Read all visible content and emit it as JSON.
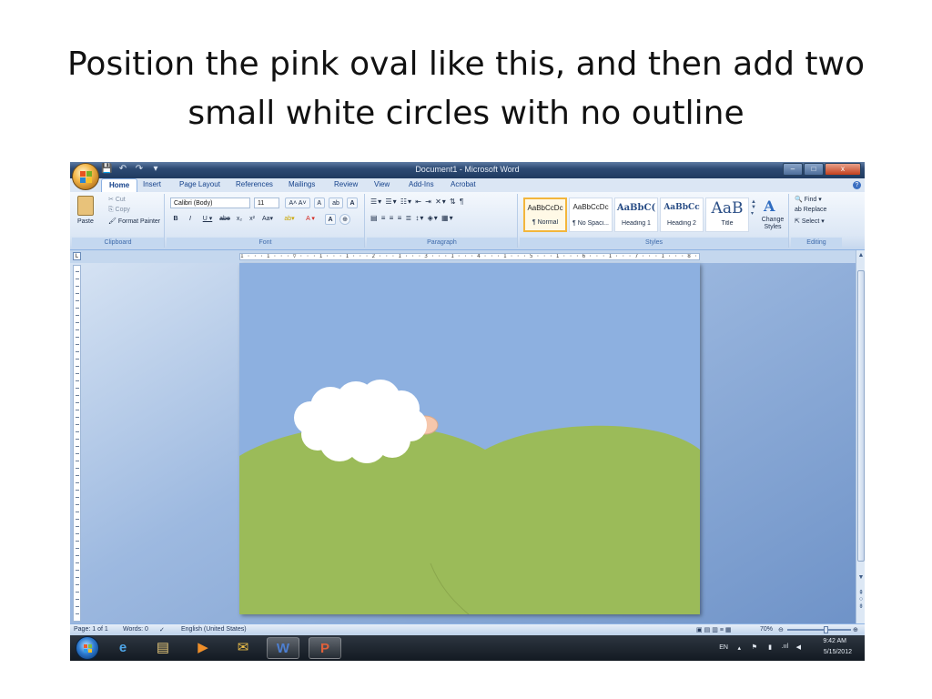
{
  "slide": {
    "title_line1": "Position the pink oval like this, and then add two",
    "title_line2": "small white circles with no outline"
  },
  "window": {
    "title": "Document1 - Microsoft Word",
    "controls": {
      "minimize": "–",
      "maximize": "□",
      "close": "x"
    }
  },
  "quick_access": {
    "save": "💾",
    "undo": "↶",
    "redo": "↷",
    "customize": "▾"
  },
  "tabs": [
    "Home",
    "Insert",
    "Page Layout",
    "References",
    "Mailings",
    "Review",
    "View",
    "Add-Ins",
    "Acrobat"
  ],
  "ribbon": {
    "clipboard": {
      "paste": "Paste",
      "cut": "Cut",
      "copy": "Copy",
      "format_painter": "Format Painter",
      "label": "Clipboard"
    },
    "font": {
      "name": "Calibri (Body)",
      "size": "11",
      "label": "Font"
    },
    "paragraph": {
      "label": "Paragraph"
    },
    "styles": {
      "items": [
        {
          "sample": "AaBbCcDc",
          "caption": "¶ Normal"
        },
        {
          "sample": "AaBbCcDc",
          "caption": "¶ No Spaci..."
        },
        {
          "sample": "AaBbC(",
          "caption": "Heading 1"
        },
        {
          "sample": "AaBbCc",
          "caption": "Heading 2"
        },
        {
          "sample": "AaB",
          "caption": "Title"
        }
      ],
      "change_styles": "Change Styles",
      "label": "Styles"
    },
    "editing": {
      "find": "Find",
      "replace": "Replace",
      "select": "Select",
      "label": "Editing"
    }
  },
  "ruler": {
    "marks": "1 · · · 1 · · · ▽ · · · 1 · · · 1 · · · 2 · · · 1 · · · 3 · · · 1 · · · 4 · · · 1 · · · 5 · · · 1 · · · 6 · · · 1 · · · 7 · · · 1 · · · 8 · · · 1 · · · ·△· · · · 1"
  },
  "status": {
    "page": "Page: 1 of 1",
    "words": "Words: 0",
    "language": "English (United States)",
    "zoom": "70%",
    "zoom_level": 0.6
  },
  "taskbar": {
    "lang": "EN",
    "time": "9:42 AM",
    "date": "5/15/2012"
  },
  "colors": {
    "sky": "#8db0e0",
    "hill": "#9bbb59",
    "cloud": "#ffffff",
    "pink_oval": "#f6c7ac"
  }
}
